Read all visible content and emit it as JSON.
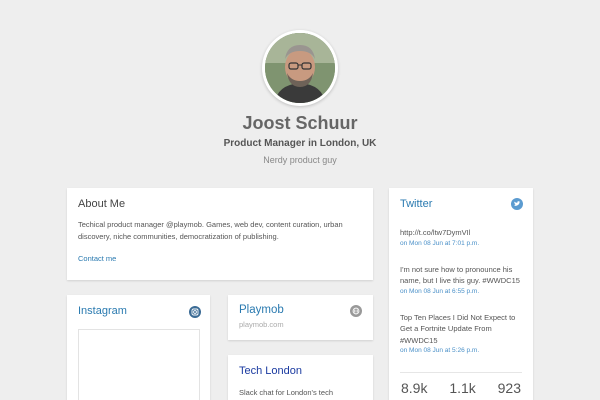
{
  "profile": {
    "name": "Joost Schuur",
    "role": "Product Manager in London, UK",
    "tagline": "Nerdy product guy"
  },
  "about": {
    "title": "About Me",
    "description": "Techical product manager @playmob. Games, web dev, content curation, urban discovery, niche communities, democratization of publishing.",
    "contact_label": "Contact me"
  },
  "instagram": {
    "title": "Instagram",
    "icon": "instagram-icon"
  },
  "playmob": {
    "title": "Playmob",
    "url": "playmob.com",
    "icon": "globe-icon"
  },
  "techlondon": {
    "title": "Tech London",
    "description": "Slack chat for London's tech"
  },
  "twitter": {
    "title": "Twitter",
    "icon": "twitter-icon",
    "tweets": [
      {
        "text": "http://t.co/ltw7DymVIl",
        "time": "on Mon 08 Jun at 7:01 p.m."
      },
      {
        "text": "I'm not sure how to pronounce his name, but I live this guy. #WWDC15",
        "time": "on Mon 08 Jun at 6:55 p.m."
      },
      {
        "text": "Top Ten Places I Did Not Expect to Get a Fortnite Update From #WWDC15",
        "time": "on Mon 08 Jun at 5:26 p.m."
      }
    ],
    "stats": [
      "8.9k",
      "1.1k",
      "923"
    ]
  },
  "colors": {
    "accent": "#2a7ab0",
    "twitter": "#5b9bd0",
    "background": "#eeeeee"
  }
}
